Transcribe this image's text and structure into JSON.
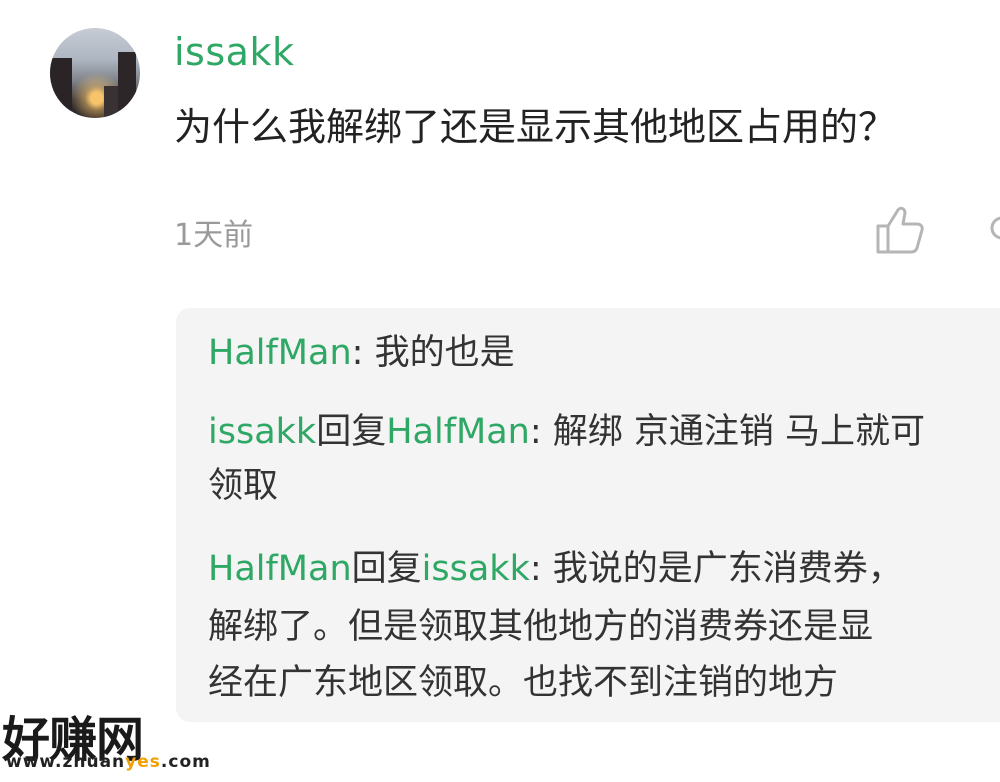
{
  "comment": {
    "username": "issakk",
    "text": "为什么我解绑了还是显示其他地区占用的？",
    "time": "1天前"
  },
  "replies": [
    {
      "name": "HalfMan",
      "sep": ":",
      "text": " 我的也是"
    },
    {
      "name": "issakk",
      "reply_word": "回复",
      "target": "HalfMan",
      "sep": ":",
      "text": " 解绑 京通注销 马上就可",
      "text_cont": "领取"
    },
    {
      "name": "HalfMan",
      "reply_word": "回复",
      "target": "issakk",
      "sep": ":",
      "text": " 我说的是广东消费券，",
      "text_cont": "解绑了。但是领取其他地方的消费券还是显",
      "text_cont2": "经在广东地区领取。也找不到注销的地方"
    }
  ],
  "watermark": {
    "title": "好赚网",
    "url_prefix": "www.zhuan",
    "url_highlight": "yes",
    "url_suffix": ".com"
  },
  "icons": {
    "like": "thumbs-up-icon",
    "more": "more-icon"
  },
  "colors": {
    "name": "#2fa865",
    "reply_bg": "#f4f4f4",
    "time": "#9a9a9a"
  }
}
